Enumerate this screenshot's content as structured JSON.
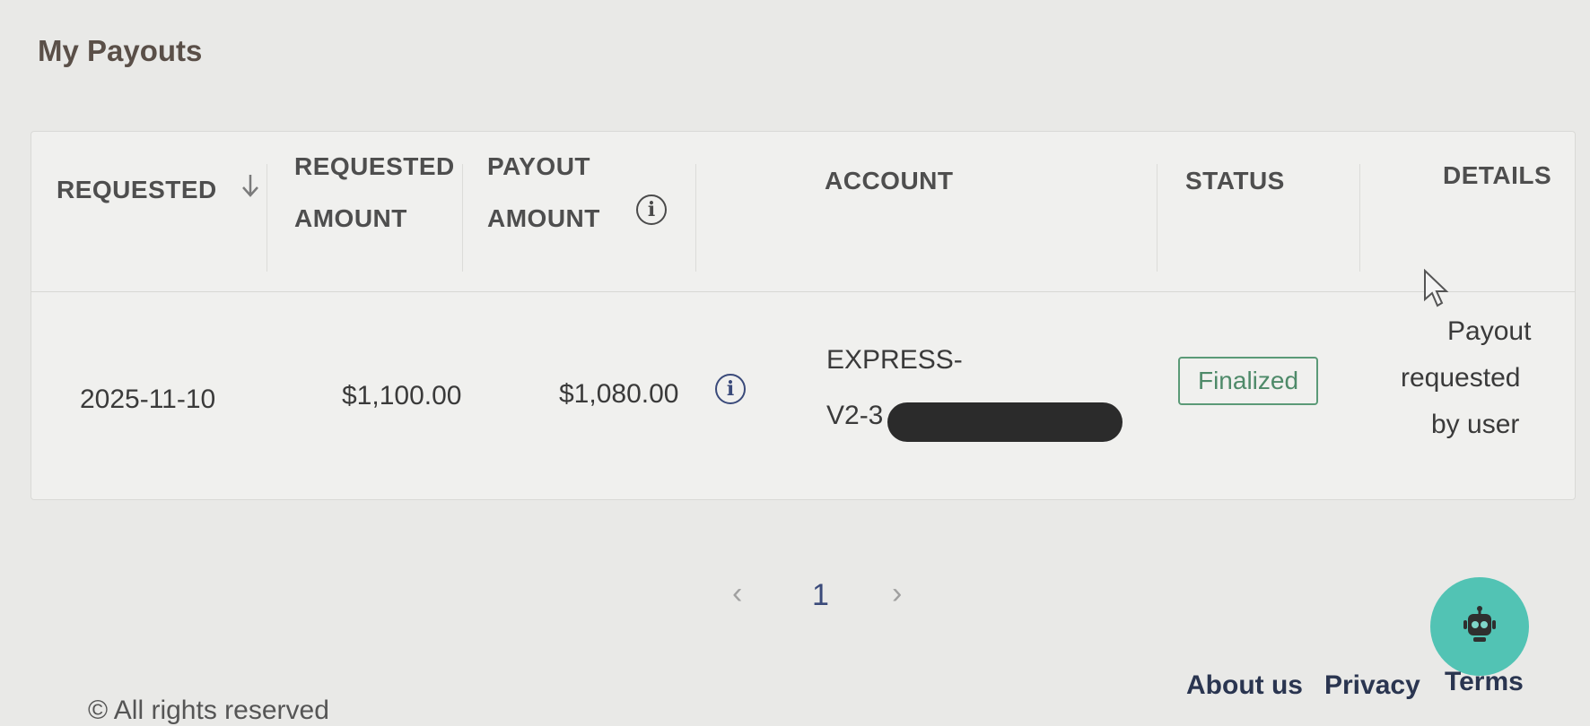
{
  "page": {
    "title": "My Payouts"
  },
  "table": {
    "headers": {
      "requested": "REQUESTED",
      "requested_amount_1": "REQUESTED",
      "requested_amount_2": "AMOUNT",
      "payout_amount_1": "PAYOUT",
      "payout_amount_2": "AMOUNT",
      "account": "ACCOUNT",
      "status": "STATUS",
      "details": "DETAILS"
    },
    "rows": [
      {
        "requested": "2025-11-10",
        "requested_amount": "$1,100.00",
        "payout_amount": "$1,080.00",
        "account_line1": "EXPRESS-",
        "account_line2": "V2-3",
        "status": "Finalized",
        "details_line1": "Payout",
        "details_line2": "requested",
        "details_line3": "by user"
      }
    ]
  },
  "pagination": {
    "prev": "‹",
    "current": "1",
    "next": "›"
  },
  "footer": {
    "copyright": "© All rights reserved",
    "links": {
      "about": "About us",
      "privacy": "Privacy",
      "terms": "Terms"
    }
  },
  "icons": {
    "sort": "arrow-down-icon",
    "info": "info-icon",
    "cursor": "mouse-cursor-icon",
    "chat_bot": "robot-icon"
  },
  "colors": {
    "status_finalized": "#4e8a69",
    "chat_button": "#52c3b4",
    "link": "#2a3550"
  }
}
